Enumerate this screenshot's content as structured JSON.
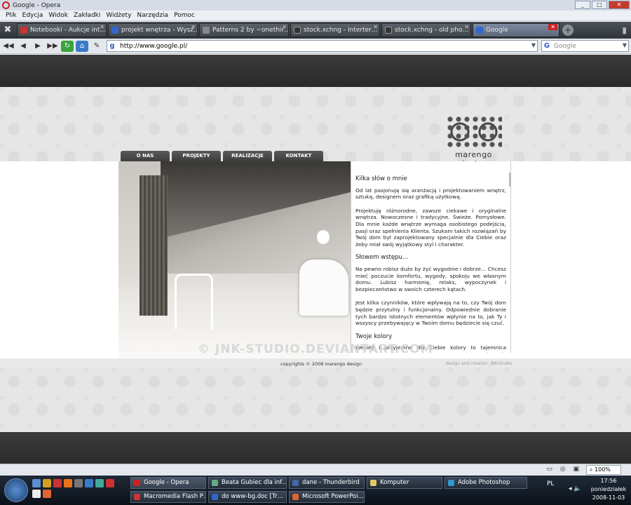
{
  "window": {
    "title": "Google - Opera",
    "controls": [
      "_",
      "□",
      "✕"
    ]
  },
  "menu": [
    "Plik",
    "Edycja",
    "Widok",
    "Zakładki",
    "Widżety",
    "Narzędzia",
    "Pomoc"
  ],
  "tabs": [
    {
      "label": "Notebooki - Aukcje int…",
      "color": "#c33"
    },
    {
      "label": "projekt wnętrza - Wysz…",
      "color": "#36c"
    },
    {
      "label": "Patterns 2 by ~onethir…",
      "color": "#888"
    },
    {
      "label": "stock.xchng - Interter…",
      "color": "#333"
    },
    {
      "label": "stock.xchng - old pho…",
      "color": "#333"
    },
    {
      "label": "Google",
      "color": "#36c",
      "active": true
    }
  ],
  "address": {
    "url": "http://www.google.pl/",
    "search_placeholder": "Google",
    "search_engine": "g"
  },
  "site": {
    "logo": "marengo design",
    "nav": [
      "O NAS",
      "PROJEKTY",
      "REALIZACJE",
      "KONTAKT"
    ],
    "sections": [
      {
        "title": "Kilka słów o mnie",
        "paragraphs": [
          "Od lat pasjonuję się aranżacją i projektowaniem wnętrz, sztuką, designem oraz grafiką użytkową.",
          "Projektuję różnorodne, zawsze ciekawe i oryginalne wnętrza. Nowoczesne i tradycyjne. Świeże. Pomysłowe. Dla mnie każde wnętrze wymaga osobistego podejścia, pasji oraz spełnienia Klienta. Szukam takich rozwiązań by Twój dom był zaprojektowany specjalnie dla Ciebie oraz żeby miał swój wyjątkowy styl i charakter."
        ]
      },
      {
        "title": "Słowem wstępu…",
        "paragraphs": [
          "Na pewno robisz dużo by żyć wygodnie i dobrze… Chcesz mieć poczucie komfortu, wygody, spokoju we własnym domu. Lubisz harmonię, relaks, wypoczynek i bezpieczeństwo w swoich czterech kątach.",
          "Jest kilka czynników, które wpływają na to, czy Twój dom będzie przytulny i funkcjonalny. Odpowiednie dobranie tych bardzo istotnych elementów wpłynie na to, jak Ty i wszyscy przebywający w Twoim domu będziecie się czuć."
        ]
      },
      {
        "title": "Twoje kolory",
        "paragraphs": [
          "Wesołe i przyjemne dla Ciebie kolory to tajemnica tworzenia Twojego nastroju i samopoczucia. Pasujące do siebie barwy"
        ]
      }
    ],
    "copyright": "copyrights © 2008 marengo design",
    "credit": "design and creation: JNK-Studio",
    "watermark": "© JNK-STUDIO.DEVIANTART.COM"
  },
  "status": {
    "zoom": "100%"
  },
  "taskbar": {
    "row1": [
      {
        "label": "Google - Opera",
        "color": "#c22",
        "active": true
      },
      {
        "label": "Beata Gubiec dla inf…",
        "color": "#6a8"
      },
      {
        "label": "dane - Thunderbird",
        "color": "#46a"
      },
      {
        "label": "Komputer",
        "color": "#dc6"
      },
      {
        "label": "Adobe Photoshop",
        "color": "#39c"
      }
    ],
    "row2": [
      {
        "label": "Macromedia Flash P…",
        "color": "#c33"
      },
      {
        "label": "do www-bg.doc [Tr…",
        "color": "#36c"
      },
      {
        "label": "Microsoft PowerPoi…",
        "color": "#d63"
      }
    ],
    "lang": "PL",
    "time": "17:56",
    "day": "poniedziałek",
    "date": "2008-11-03"
  }
}
